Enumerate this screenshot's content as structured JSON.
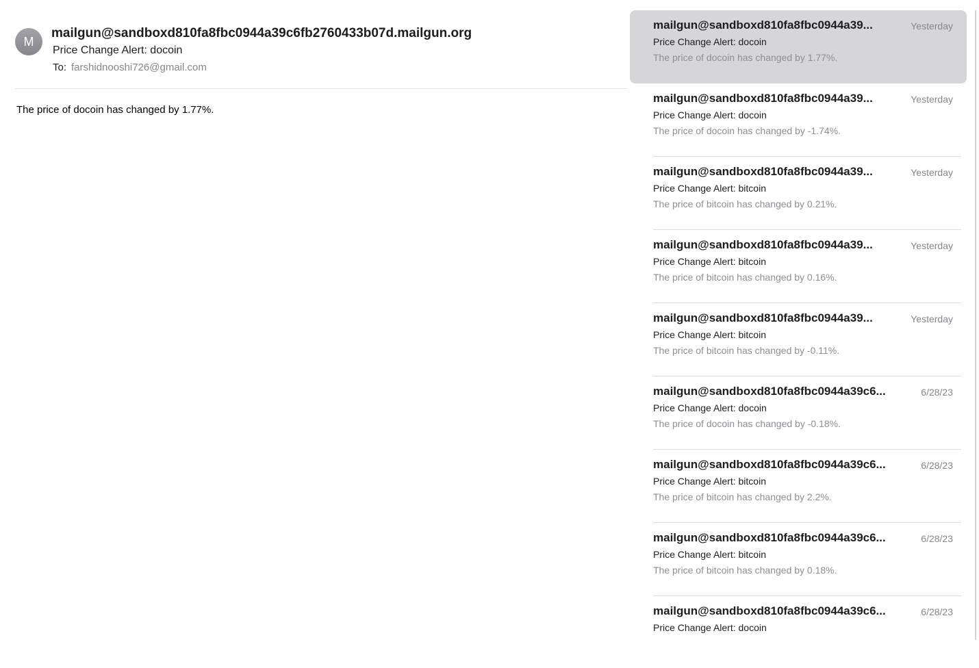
{
  "viewer": {
    "avatar_initial": "M",
    "sender": "mailgun@sandboxd810fa8fbc0944a39c6fb2760433b07d.mailgun.org",
    "subject": "Price Change Alert: docoin",
    "to_label": "To:",
    "to_address": "farshidnooshi726@gmail.com",
    "body": "The price of docoin has changed by 1.77%."
  },
  "messages": [
    {
      "sender": "mailgun@sandboxd810fa8fbc0944a39...",
      "date": "Yesterday",
      "subject": "Price Change Alert: docoin",
      "preview": "The price of docoin has changed by 1.77%.",
      "selected": true
    },
    {
      "sender": "mailgun@sandboxd810fa8fbc0944a39...",
      "date": "Yesterday",
      "subject": "Price Change Alert: docoin",
      "preview": "The price of docoin has changed by -1.74%.",
      "selected": false
    },
    {
      "sender": "mailgun@sandboxd810fa8fbc0944a39...",
      "date": "Yesterday",
      "subject": "Price Change Alert: bitcoin",
      "preview": "The price of bitcoin has changed by 0.21%.",
      "selected": false
    },
    {
      "sender": "mailgun@sandboxd810fa8fbc0944a39...",
      "date": "Yesterday",
      "subject": "Price Change Alert: bitcoin",
      "preview": "The price of bitcoin has changed by 0.16%.",
      "selected": false
    },
    {
      "sender": "mailgun@sandboxd810fa8fbc0944a39...",
      "date": "Yesterday",
      "subject": "Price Change Alert: bitcoin",
      "preview": "The price of bitcoin has changed by -0.11%.",
      "selected": false
    },
    {
      "sender": "mailgun@sandboxd810fa8fbc0944a39c6...",
      "date": "6/28/23",
      "subject": "Price Change Alert: docoin",
      "preview": "The price of docoin has changed by -0.18%.",
      "selected": false
    },
    {
      "sender": "mailgun@sandboxd810fa8fbc0944a39c6...",
      "date": "6/28/23",
      "subject": "Price Change Alert: bitcoin",
      "preview": "The price of bitcoin has changed by 2.2%.",
      "selected": false
    },
    {
      "sender": "mailgun@sandboxd810fa8fbc0944a39c6...",
      "date": "6/28/23",
      "subject": "Price Change Alert: bitcoin",
      "preview": "The price of bitcoin has changed by 0.18%.",
      "selected": false
    },
    {
      "sender": "mailgun@sandboxd810fa8fbc0944a39c6...",
      "date": "6/28/23",
      "subject": "Price Change Alert: docoin",
      "preview": "",
      "selected": false
    }
  ]
}
